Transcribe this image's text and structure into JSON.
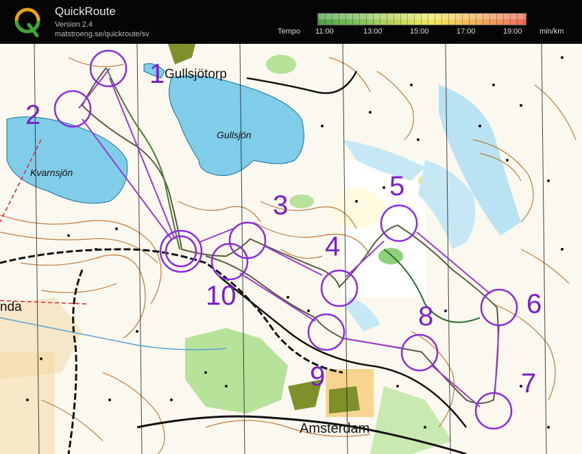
{
  "app": {
    "title": "QuickRoute",
    "version": "Version 2.4",
    "url": "matstroeng.se/quickroute/sv",
    "logo_letter": "Q"
  },
  "speed_scale": {
    "label": "Tempo",
    "ticks": [
      "11:00",
      "13:00",
      "15:00",
      "17:00",
      "19:00"
    ],
    "unit": "min/km",
    "colors": [
      "#4aa14a",
      "#7cc05a",
      "#c7d85a",
      "#f1e85c",
      "#f2b45a",
      "#ee6a5a"
    ]
  },
  "map": {
    "place_names": [
      "Gullsjötorp",
      "Amsterdam",
      "nda"
    ],
    "lake_names": [
      "Gullsjön",
      "Kvarnsjön"
    ],
    "control_numbers": [
      "1",
      "2",
      "3",
      "4",
      "5",
      "6",
      "7",
      "8",
      "9",
      "10"
    ],
    "control_color": "#8a2be2",
    "water_color": "#7fcde8",
    "forest_color": "#b7e29a",
    "contour_color": "#c07a3a"
  }
}
